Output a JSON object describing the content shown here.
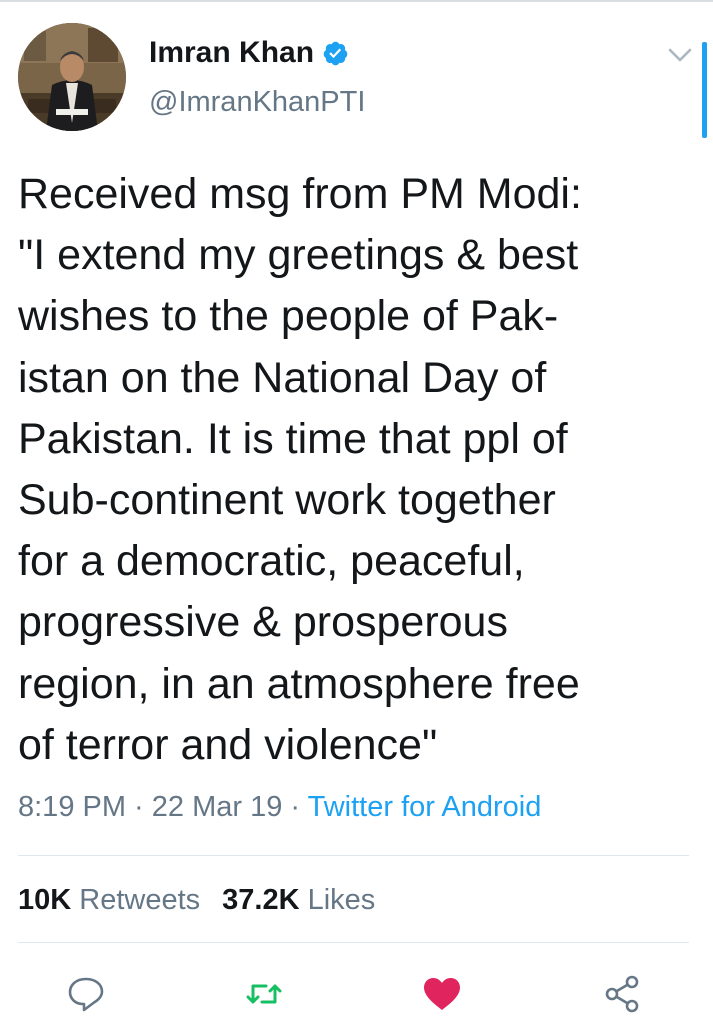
{
  "tweet": {
    "author_name": "Imran Khan",
    "handle": "@ImranKhanPTI",
    "verified": true,
    "text": "Received msg from PM Modi:\n\"I extend my greetings & best\nwishes to the people of Pak-\nistan on the National Day of\nPakistan. It is time that ppl of\nSub-continent work together\nfor a democratic, peaceful,\nprogressive & prosperous\nregion, in an atmosphere free\nof terror and violence\"",
    "time": "8:19 PM",
    "separator": " · ",
    "date": "22 Mar 19",
    "source": "Twitter for Android"
  },
  "stats": {
    "retweets_count": "10K",
    "retweets_label": "Retweets",
    "likes_count": "37.2K",
    "likes_label": "Likes"
  },
  "icons": {
    "verified": "verified-badge-icon",
    "caret": "chevron-down-icon",
    "reply": "reply-icon",
    "retweet": "retweet-icon",
    "like": "heart-icon",
    "share": "share-icon"
  },
  "colors": {
    "accent": "#1da1f2",
    "retweet": "#17bf63",
    "like": "#e0245e",
    "secondary_text": "#657786",
    "primary_text": "#14171a"
  }
}
